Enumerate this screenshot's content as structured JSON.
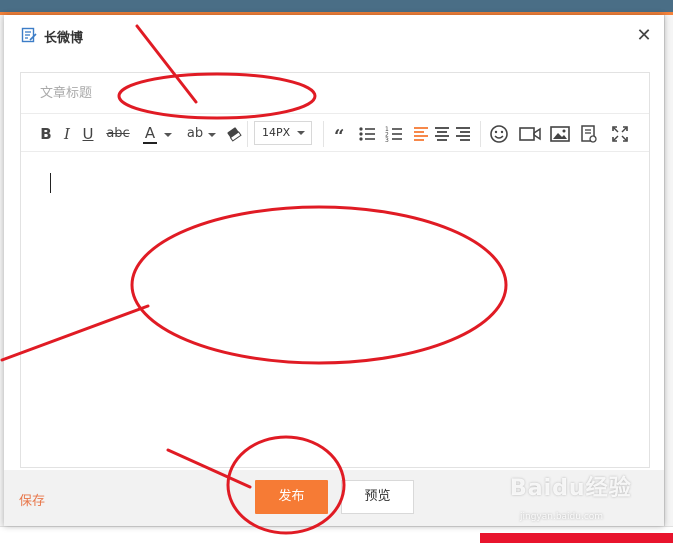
{
  "dialog": {
    "title": "长微博",
    "icon": "edit-document-icon",
    "close_icon": "close-icon"
  },
  "editor": {
    "title_placeholder": "文章标题",
    "title_value": "",
    "content_value": "",
    "font_size": "14PX"
  },
  "toolbar": {
    "bold_label": "B",
    "italic_label": "I",
    "underline_label": "U",
    "strike_label": "abc",
    "font_color_label": "A",
    "highlight_label": "ab",
    "accent_color": "#f67b35",
    "font_color_underline": "#222222"
  },
  "footer": {
    "save_label": "保存",
    "publish_label": "发布",
    "preview_label": "预览"
  },
  "watermark": {
    "brand": "Baidu经验",
    "url": "jingyan.baidu.com"
  },
  "annotation_color": "#e01b24"
}
